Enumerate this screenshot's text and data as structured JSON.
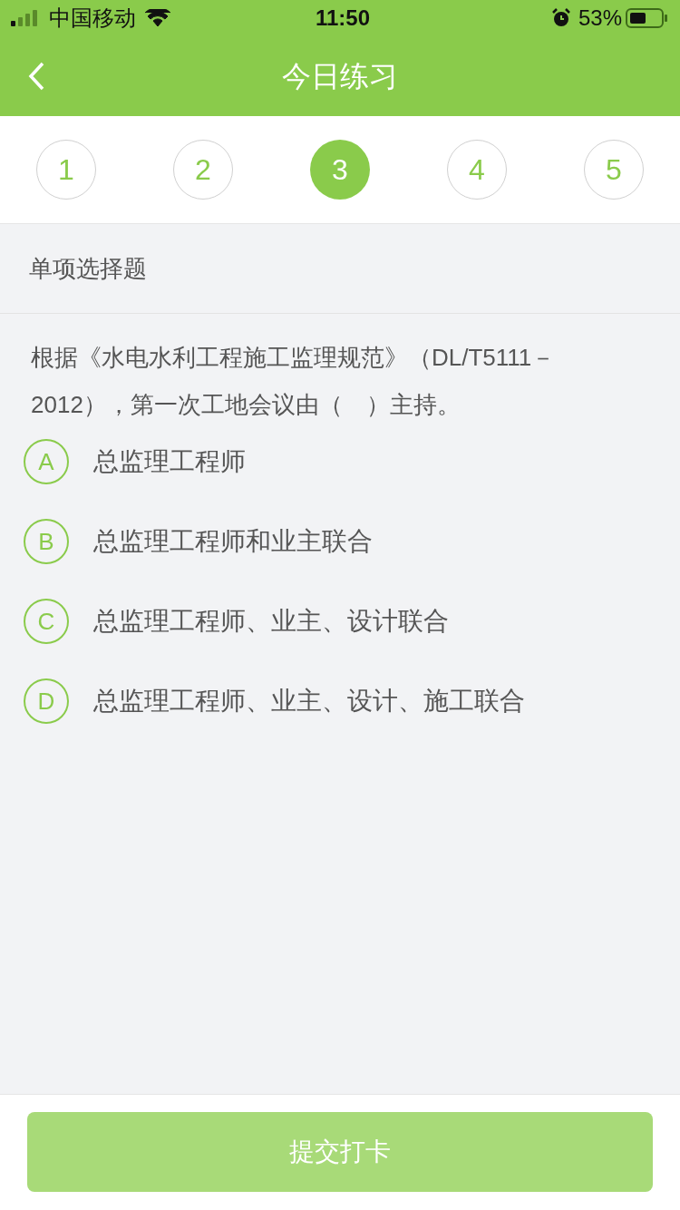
{
  "status_bar": {
    "carrier": "中国移动",
    "time": "11:50",
    "battery": "53%"
  },
  "nav": {
    "title": "今日练习"
  },
  "steps": [
    {
      "label": "1",
      "selected": false
    },
    {
      "label": "2",
      "selected": false
    },
    {
      "label": "3",
      "selected": true
    },
    {
      "label": "4",
      "selected": false
    },
    {
      "label": "5",
      "selected": false
    }
  ],
  "section": {
    "title": "单项选择题"
  },
  "question": "根据《水电水利工程施工监理规范》（DL/T5111－2012），第一次工地会议由（　）主持。",
  "options": [
    {
      "letter": "A",
      "text": "总监理工程师",
      "selected": false
    },
    {
      "letter": "B",
      "text": "总监理工程师和业主联合",
      "selected": false
    },
    {
      "letter": "C",
      "text": "总监理工程师、业主、设计联合",
      "selected": false
    },
    {
      "letter": "D",
      "text": "总监理工程师、业主、设计、施工联合",
      "selected": false
    }
  ],
  "submit": {
    "label": "提交打卡",
    "disabled": true
  }
}
